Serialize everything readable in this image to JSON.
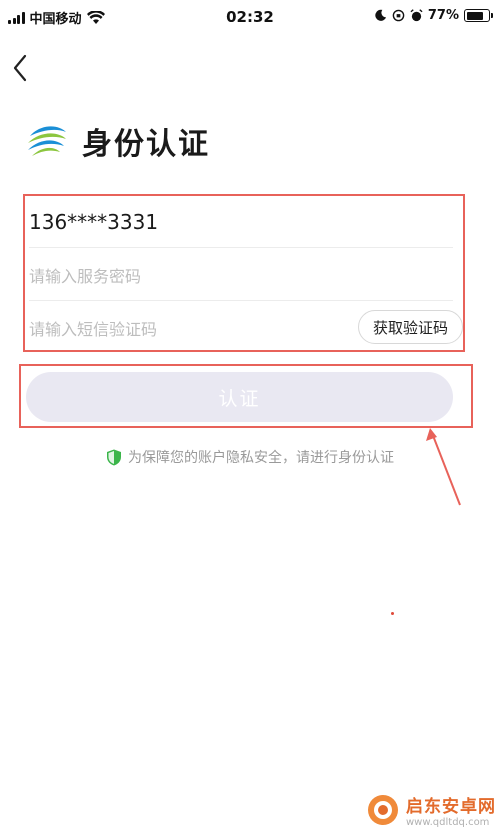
{
  "status_bar": {
    "carrier": "中国移动",
    "time": "02:32",
    "battery": "77%",
    "battery_level": 0.77
  },
  "header": {
    "title": "身份认证",
    "logo_icon": "china-mobile-logo"
  },
  "form": {
    "phone_value": "136****3331",
    "password_placeholder": "请输入服务密码",
    "sms_placeholder": "请输入短信验证码",
    "get_code_label": "获取验证码"
  },
  "submit": {
    "label": "认证"
  },
  "notice": {
    "text": "为保障您的账户隐私安全，请进行身份认证"
  },
  "watermark": {
    "name": "启东安卓网",
    "url": "www.qdltdq.com"
  },
  "colors": {
    "highlight": "#e8625a",
    "button_disabled": "#e9e8f2",
    "shield_green": "#3bb54a"
  }
}
